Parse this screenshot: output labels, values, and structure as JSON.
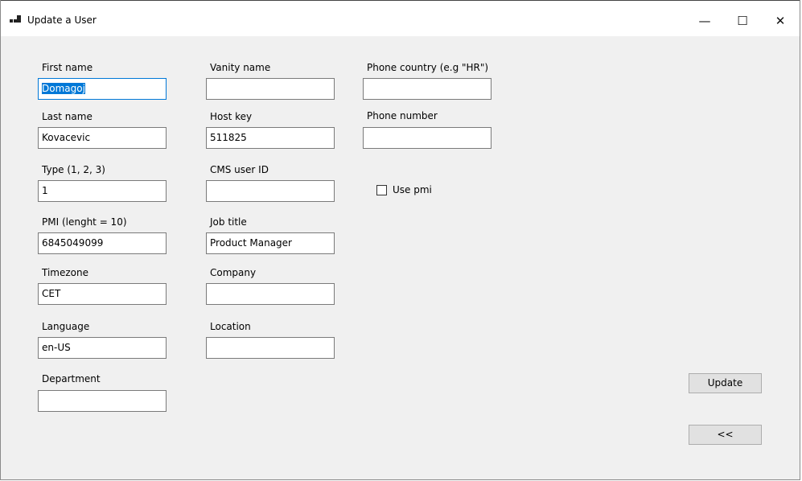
{
  "window": {
    "title": "Update a User",
    "minimize_glyph": "—",
    "maximize_glyph": "☐",
    "close_glyph": "✕"
  },
  "fields": {
    "first_name": {
      "label": "First name",
      "value": "Domagoj"
    },
    "last_name": {
      "label": "Last name",
      "value": "Kovacevic"
    },
    "type": {
      "label": "Type (1, 2, 3)",
      "value": "1"
    },
    "pmi": {
      "label": "PMI (lenght = 10)",
      "value": "6845049099"
    },
    "timezone": {
      "label": "Timezone",
      "value": "CET"
    },
    "language": {
      "label": "Language",
      "value": "en-US"
    },
    "department": {
      "label": "Department",
      "value": ""
    },
    "vanity_name": {
      "label": "Vanity name",
      "value": ""
    },
    "host_key": {
      "label": "Host key",
      "value": "511825"
    },
    "cms_user_id": {
      "label": "CMS user ID",
      "value": ""
    },
    "job_title": {
      "label": "Job title",
      "value": "Product Manager"
    },
    "company": {
      "label": "Company",
      "value": ""
    },
    "location": {
      "label": "Location",
      "value": ""
    },
    "phone_country": {
      "label": "Phone country (e.g \"HR\")",
      "value": ""
    },
    "phone_number": {
      "label": "Phone number",
      "value": ""
    }
  },
  "use_pmi": {
    "label": "Use pmi",
    "checked": false
  },
  "buttons": {
    "update": "Update",
    "back": "<<"
  }
}
